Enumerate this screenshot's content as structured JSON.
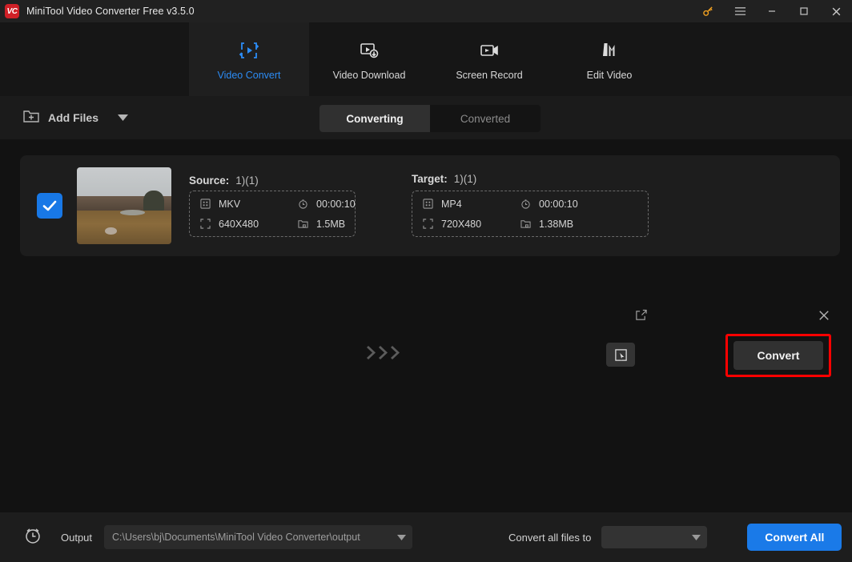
{
  "titlebar": {
    "app_name": "MiniTool Video Converter Free v3.5.0",
    "logo_text": "VC",
    "logo_color": "#cf2027",
    "controls": [
      {
        "name": "key-icon",
        "label": "Key"
      },
      {
        "name": "menu-icon",
        "label": "Menu"
      },
      {
        "name": "minimize-icon",
        "label": "Minimize"
      },
      {
        "name": "maximize-icon",
        "label": "Maximize"
      },
      {
        "name": "close-icon",
        "label": "Close"
      }
    ]
  },
  "nav": {
    "active_color": "#2c8cf5",
    "items": [
      {
        "label": "Video Convert",
        "icon": "video-convert-icon",
        "active": true
      },
      {
        "label": "Video Download",
        "icon": "video-download-icon",
        "active": false
      },
      {
        "label": "Screen Record",
        "icon": "screen-record-icon",
        "active": false
      },
      {
        "label": "Edit Video",
        "icon": "edit-video-icon",
        "active": false
      }
    ]
  },
  "toolbar": {
    "add_files_label": "Add Files",
    "tabs": [
      {
        "label": "Converting",
        "active": true
      },
      {
        "label": "Converted",
        "active": false
      }
    ]
  },
  "file_card": {
    "checked": true,
    "source": {
      "title": "Source:",
      "count": "1)(1)",
      "format": "MKV",
      "duration": "00:00:10",
      "resolution": "640X480",
      "size": "1.5MB"
    },
    "target": {
      "title": "Target:",
      "count": "1)(1)",
      "format": "MP4",
      "duration": "00:00:10",
      "resolution": "720X480",
      "size": "1.38MB"
    },
    "convert_label": "Convert",
    "highlight_color": "#fe0000"
  },
  "bottombar": {
    "output_label": "Output",
    "output_path": "C:\\Users\\bj\\Documents\\MiniTool Video Converter\\output",
    "convert_all_files_to_label": "Convert all files to",
    "convert_all_files_to_value": "",
    "convert_all_label": "Convert All",
    "convert_all_color": "#1a7ae8"
  }
}
